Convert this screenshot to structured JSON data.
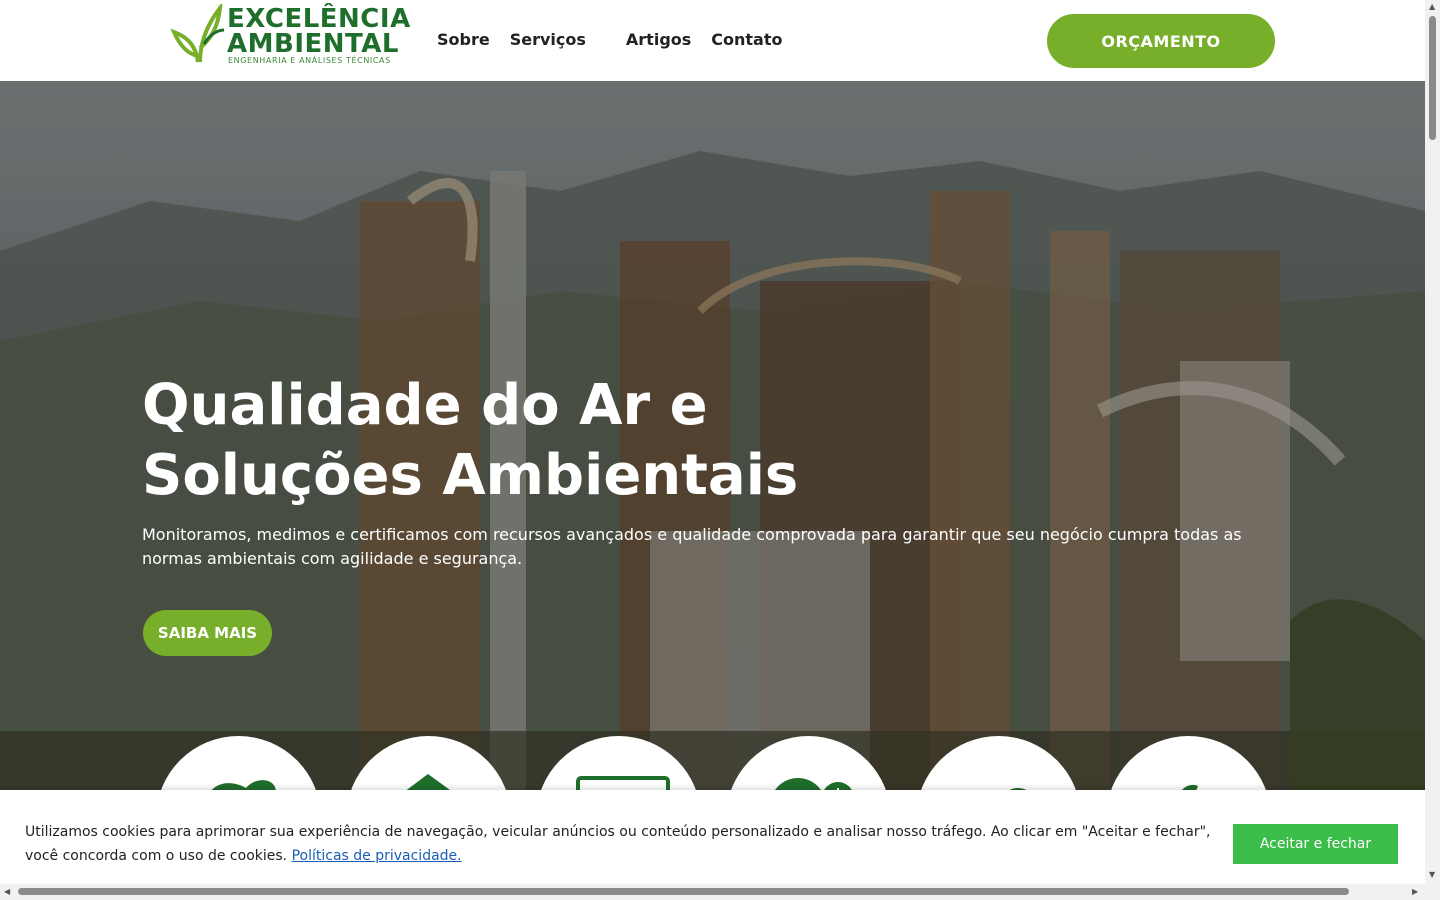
{
  "brand": {
    "line1": "EXCELÊNCIA",
    "line2": "AMBIENTAL",
    "tagline": "ENGENHARIA E ANÁLISES TÉCNICAS",
    "color": "#1f6e2b",
    "accent": "#77af2a"
  },
  "nav": {
    "items": [
      "Sobre",
      "Serviços",
      "Artigos",
      "Contato"
    ]
  },
  "header": {
    "cta_label": "ORÇAMENTO"
  },
  "hero": {
    "title_line1": "Qualidade do Ar e",
    "title_line2": "Soluções Ambientais",
    "subtitle": "Monitoramos, medimos e certificamos com recursos avançados e qualidade comprovada para garantir que seu negócio cumpra todas as normas ambientais com agilidade e segurança.",
    "button_label": "SAIBA MAIS"
  },
  "services": {
    "icons": [
      "smoke-icon",
      "roof-icon",
      "monitor-icon",
      "globe-leaf-icon",
      "animals-icon",
      "plant-icon"
    ]
  },
  "cookie": {
    "text": "Utilizamos cookies para aprimorar sua experiência de navegação, veicular anúncios ou conteúdo personalizado e analisar nosso tráfego. Ao clicar em \"Aceitar e fechar\", você concorda com o uso de cookies.",
    "link_label": "Políticas de privacidade.",
    "accept_label": "Aceitar e fechar",
    "accept_color": "#3bbd4a"
  }
}
